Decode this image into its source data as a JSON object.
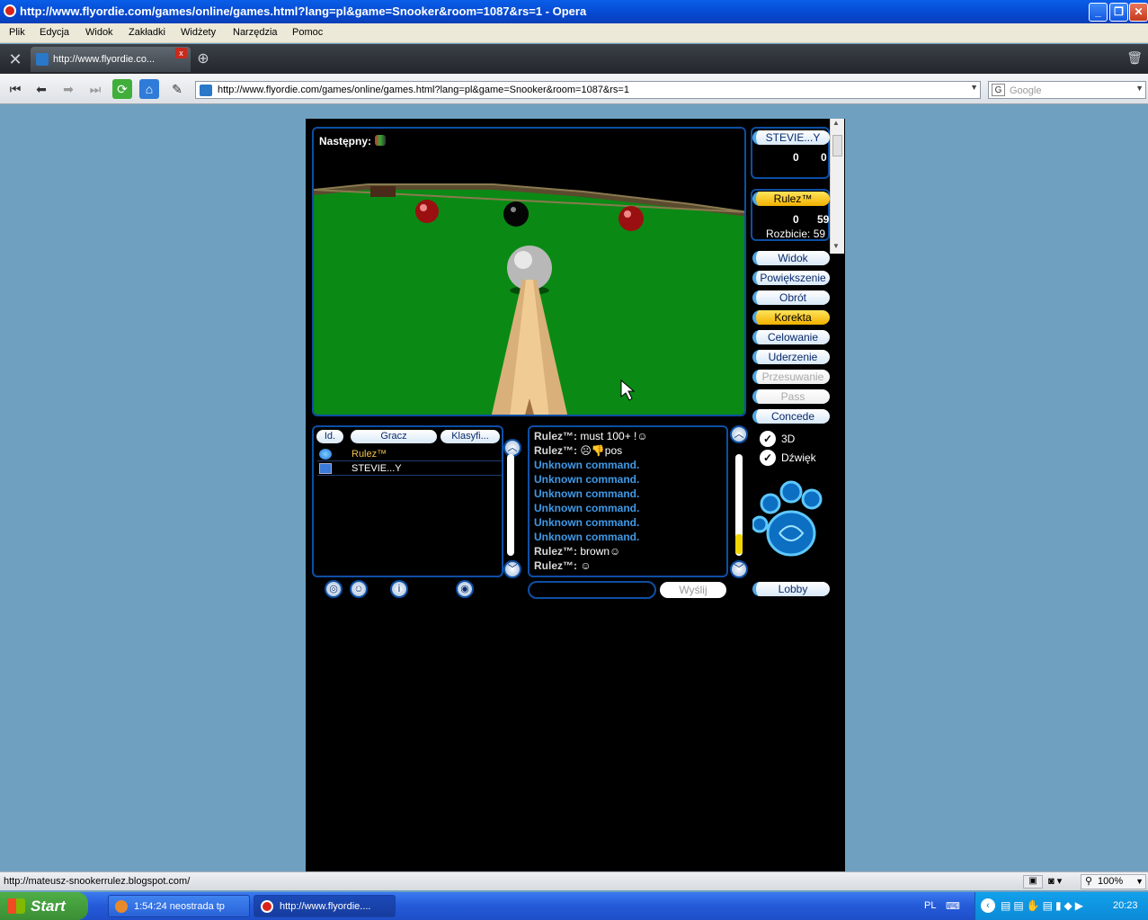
{
  "window": {
    "title": "http://www.flyordie.com/games/online/games.html?lang=pl&game=Snooker&room=1087&rs=1 - Opera"
  },
  "menu": [
    "Plik",
    "Edycja",
    "Widok",
    "Zakładki",
    "Widżety",
    "Narzędzia",
    "Pomoc"
  ],
  "tab": {
    "label": "http://www.flyordie.co..."
  },
  "address": {
    "url": "http://www.flyordie.com/games/online/games.html?lang=pl&game=Snooker&room=1087&rs=1",
    "search_placeholder": "Google"
  },
  "game": {
    "next_label": "Następny:",
    "players_panel": [
      {
        "name": "STEVIE...Y",
        "score_a": "0",
        "score_b": "0"
      },
      {
        "name": "Rulez™",
        "score_a": "0",
        "score_b": "59",
        "break_label": "Rozbicie: 59"
      }
    ],
    "buttons": [
      "Widok",
      "Powiększenie",
      "Obrót",
      "Korekta",
      "Celowanie",
      "Uderzenie",
      "Przesuwanie",
      "Pass",
      "Concede"
    ],
    "checkboxes": [
      "3D",
      "Dźwięk"
    ],
    "lobby_label": "Lobby",
    "list_headers": [
      "Id.",
      "Gracz",
      "Klasyfi..."
    ],
    "players": [
      "Rulez™",
      "STEVIE...Y"
    ],
    "chat": [
      {
        "who": "Rulez™:",
        "text": "must 100+ !☺"
      },
      {
        "who": "Rulez™:",
        "text": "☹👎pos"
      },
      {
        "who": "",
        "text": "Unknown command."
      },
      {
        "who": "",
        "text": "Unknown command."
      },
      {
        "who": "",
        "text": "Unknown command."
      },
      {
        "who": "",
        "text": "Unknown command."
      },
      {
        "who": "",
        "text": "Unknown command."
      },
      {
        "who": "",
        "text": "Unknown command."
      },
      {
        "who": "Rulez™:",
        "text": "brown☺"
      },
      {
        "who": "Rulez™:",
        "text": "☺"
      }
    ],
    "send_label": "Wyślij"
  },
  "status": {
    "text": "http://mateusz-snookerrulez.blogspot.com/",
    "zoom": "100%"
  },
  "taskbar": {
    "start": "Start",
    "tasks": [
      "1:54:24 neostrada tp",
      "http://www.flyordie...."
    ],
    "lang": "PL",
    "clock": "20:23"
  }
}
